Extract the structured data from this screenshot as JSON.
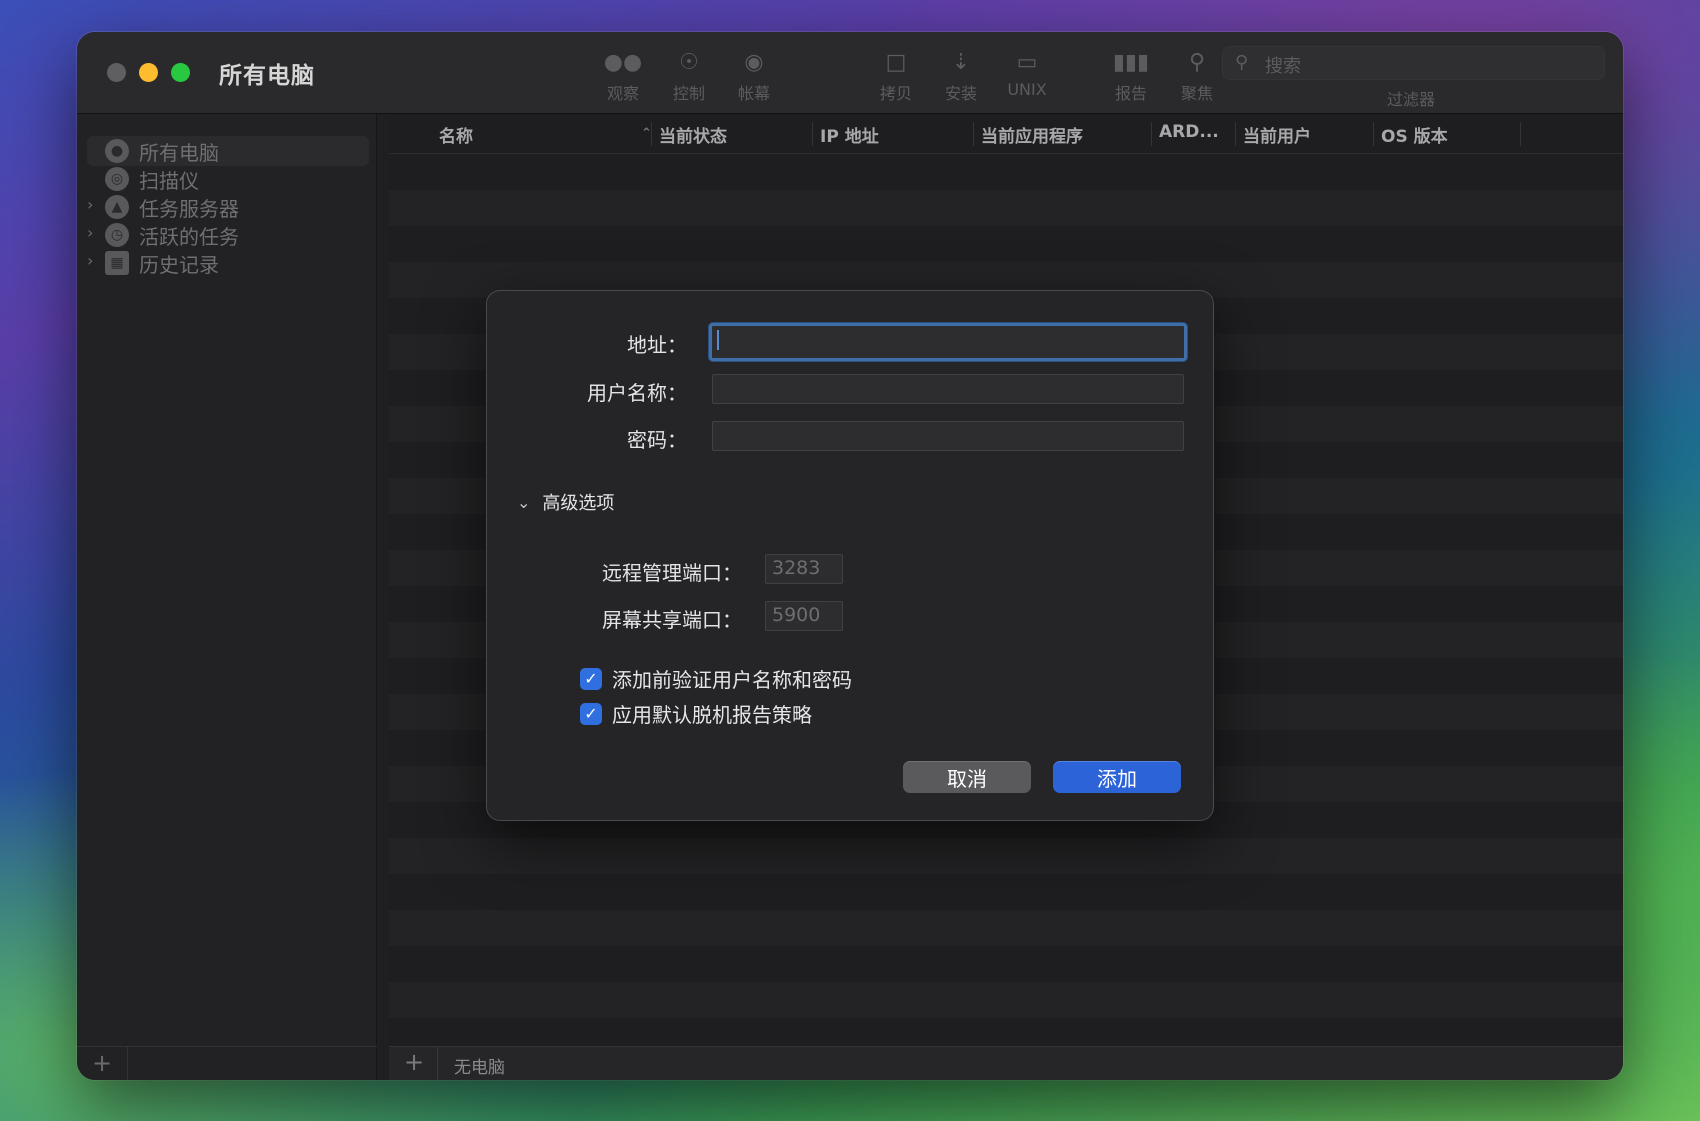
{
  "window": {
    "title": "所有电脑"
  },
  "toolbar": {
    "items": [
      {
        "label": "观察",
        "icon": "binoculars-icon"
      },
      {
        "label": "控制",
        "icon": "control-icon"
      },
      {
        "label": "帐幕",
        "icon": "eye-icon"
      },
      {
        "label": "拷贝",
        "icon": "copy-document-icon"
      },
      {
        "label": "安装",
        "icon": "install-icon"
      },
      {
        "label": "UNIX",
        "icon": "terminal-icon"
      },
      {
        "label": "报告",
        "icon": "chart-icon"
      },
      {
        "label": "聚焦",
        "icon": "magnifier-icon"
      }
    ],
    "search_placeholder": "搜索",
    "filter_label": "过滤器"
  },
  "sidebar": {
    "items": [
      {
        "label": "所有电脑",
        "icon": "computers-icon",
        "expandable": false
      },
      {
        "label": "扫描仪",
        "icon": "scanner-icon",
        "expandable": false
      },
      {
        "label": "任务服务器",
        "icon": "task-server-icon",
        "expandable": true
      },
      {
        "label": "活跃的任务",
        "icon": "clock-icon",
        "expandable": true
      },
      {
        "label": "历史记录",
        "icon": "calendar-icon",
        "expandable": true
      }
    ]
  },
  "table": {
    "columns": [
      "名称",
      "当前状态",
      "IP 地址",
      "当前应用程序",
      "ARD...",
      "当前用户",
      "OS 版本"
    ],
    "status": "无电脑"
  },
  "dialog": {
    "address_label": "地址：",
    "address_value": "",
    "username_label": "用户名称：",
    "username_value": "",
    "password_label": "密码：",
    "password_value": "",
    "advanced_label": "高级选项",
    "remote_port_label": "远程管理端口：",
    "remote_port_value": "3283",
    "screen_port_label": "屏幕共享端口：",
    "screen_port_value": "5900",
    "verify_label": "添加前验证用户名称和密码",
    "verify_checked": true,
    "offline_label": "应用默认脱机报告策略",
    "offline_checked": true,
    "cancel_label": "取消",
    "add_label": "添加"
  },
  "colors": {
    "accent": "#2c64d8",
    "focus_ring": "#3f6fa8"
  }
}
